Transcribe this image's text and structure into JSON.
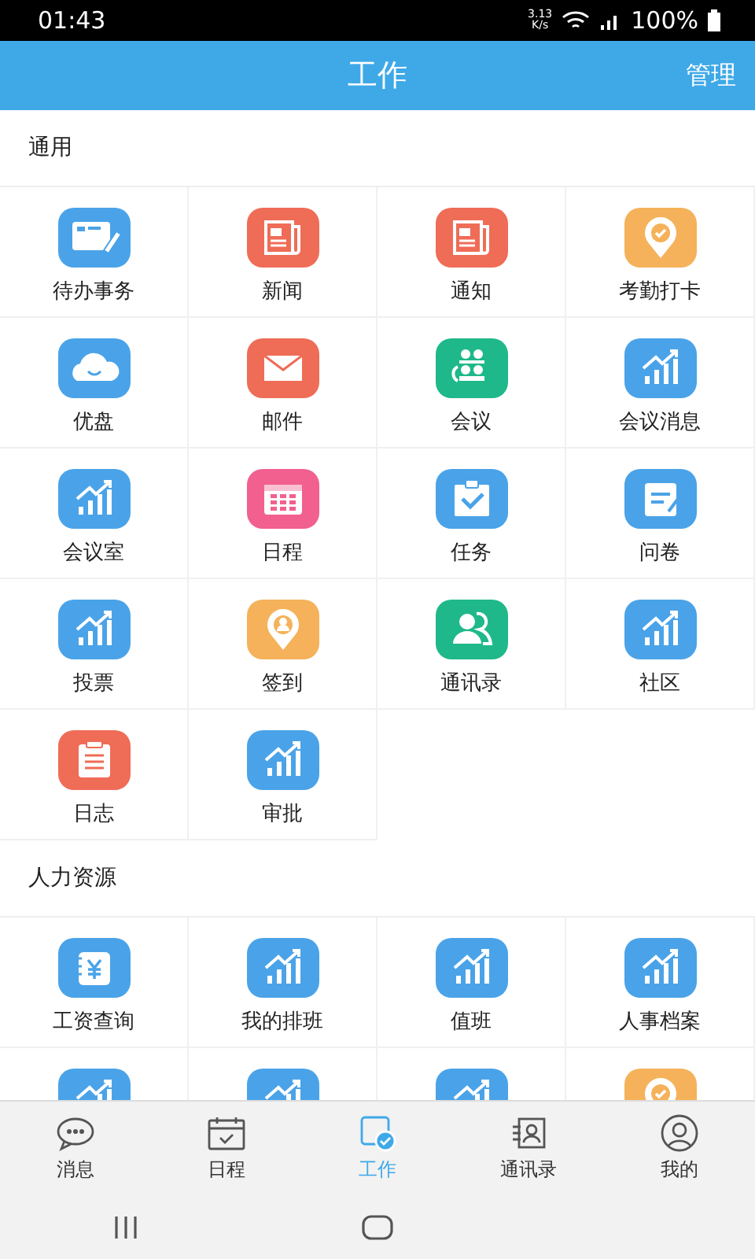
{
  "status_bar": {
    "time": "01:43",
    "speed": "3.13\nK/s",
    "battery": "100%"
  },
  "app_bar": {
    "title": "工作",
    "action": "管理"
  },
  "sections": [
    {
      "title": "通用",
      "items": [
        {
          "label": "待办事务",
          "kind": "card",
          "color": "#4aa3e8"
        },
        {
          "label": "新闻",
          "kind": "news",
          "color": "#ef6c57"
        },
        {
          "label": "通知",
          "kind": "news",
          "color": "#ef6c57"
        },
        {
          "label": "考勤打卡",
          "kind": "pincheck",
          "color": "#f5b25a"
        },
        {
          "label": "优盘",
          "kind": "cloud",
          "color": "#4aa3e8"
        },
        {
          "label": "邮件",
          "kind": "mail",
          "color": "#ef6c57"
        },
        {
          "label": "会议",
          "kind": "people",
          "color": "#1fb88a"
        },
        {
          "label": "会议消息",
          "kind": "chart",
          "color": "#4aa3e8"
        },
        {
          "label": "会议室",
          "kind": "chart",
          "color": "#4aa3e8"
        },
        {
          "label": "日程",
          "kind": "calendar",
          "color": "#f1608e"
        },
        {
          "label": "任务",
          "kind": "clipcheck",
          "color": "#4aa3e8"
        },
        {
          "label": "问卷",
          "kind": "clipedit",
          "color": "#4aa3e8"
        },
        {
          "label": "投票",
          "kind": "chart",
          "color": "#4aa3e8"
        },
        {
          "label": "签到",
          "kind": "pinperson",
          "color": "#f5b25a"
        },
        {
          "label": "通讯录",
          "kind": "contacts",
          "color": "#1fb88a"
        },
        {
          "label": "社区",
          "kind": "chart",
          "color": "#4aa3e8"
        },
        {
          "label": "日志",
          "kind": "notepad",
          "color": "#ef6c57"
        },
        {
          "label": "审批",
          "kind": "chart",
          "color": "#4aa3e8"
        }
      ]
    },
    {
      "title": "人力资源",
      "items": [
        {
          "label": "工资查询",
          "kind": "yen",
          "color": "#4aa3e8"
        },
        {
          "label": "我的排班",
          "kind": "chart",
          "color": "#4aa3e8"
        },
        {
          "label": "值班",
          "kind": "chart",
          "color": "#4aa3e8"
        },
        {
          "label": "人事档案",
          "kind": "chart",
          "color": "#4aa3e8"
        },
        {
          "kind": "chart",
          "color": "#4aa3e8"
        },
        {
          "kind": "chart",
          "color": "#4aa3e8"
        },
        {
          "kind": "chart",
          "color": "#4aa3e8"
        },
        {
          "kind": "pincheck",
          "color": "#f5b25a"
        }
      ]
    }
  ],
  "tabs": [
    {
      "label": "消息",
      "kind": "chat",
      "selected": false
    },
    {
      "label": "日程",
      "kind": "calendar",
      "selected": false
    },
    {
      "label": "工作",
      "kind": "work",
      "selected": true
    },
    {
      "label": "通讯录",
      "kind": "contacts",
      "selected": false
    },
    {
      "label": "我的",
      "kind": "user",
      "selected": false
    }
  ]
}
